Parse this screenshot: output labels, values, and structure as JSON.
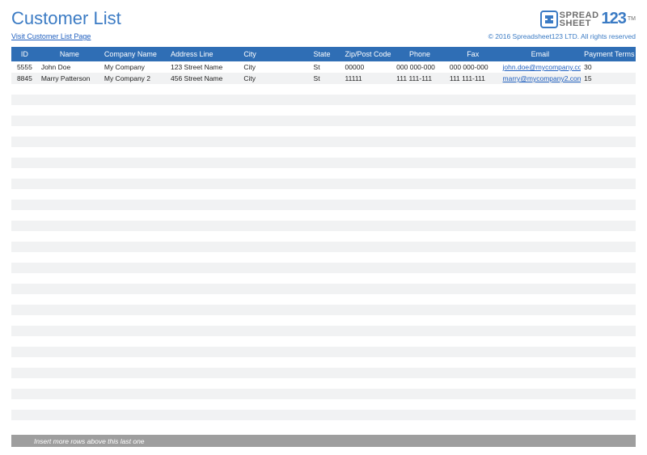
{
  "header": {
    "title": "Customer List",
    "visit_link": "Visit Customer List Page",
    "copyright": "© 2016 Spreadsheet123 LTD. All rights reserved",
    "logo": {
      "word1": "SPREAD",
      "word2": "SHEET",
      "num": "123",
      "tm": "TM"
    }
  },
  "columns": {
    "id": "ID",
    "name": "Name",
    "company": "Company Name",
    "address": "Address Line",
    "city": "City",
    "state": "State",
    "zip": "Zip/Post Code",
    "phone": "Phone",
    "fax": "Fax",
    "email": "Email",
    "payment": "Payment Terms"
  },
  "rows": [
    {
      "id": "5555",
      "name": "John Doe",
      "company": "My Company",
      "address": "123 Street Name",
      "city": "City",
      "state": "St",
      "zip": "00000",
      "phone": "000 000-000",
      "fax": "000 000-000",
      "email": "john.doe@mycompany.co",
      "payment": "30"
    },
    {
      "id": "8845",
      "name": "Marry Patterson",
      "company": "My Company 2",
      "address": "456 Street Name",
      "city": "City",
      "state": "St",
      "zip": "11111",
      "phone": "111 111-111",
      "fax": "111 111-111",
      "email": "marry@mycompany2.con",
      "payment": "15"
    }
  ],
  "empty_row_count": 33,
  "footer": {
    "note": "Insert more rows above this last one"
  }
}
